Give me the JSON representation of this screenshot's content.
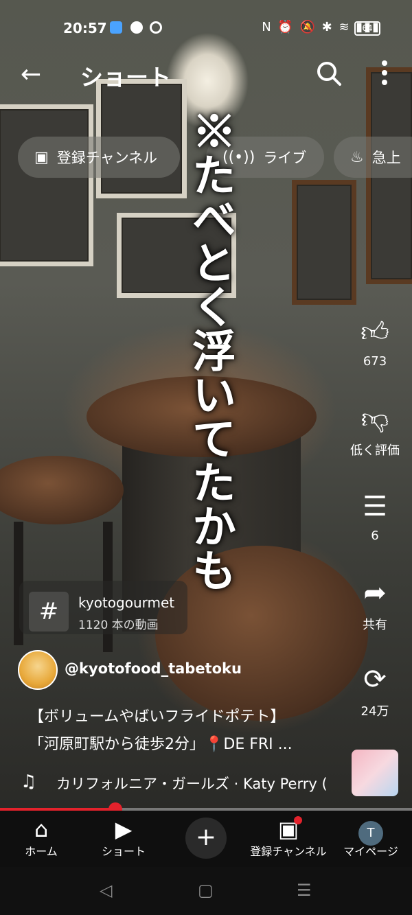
{
  "status_bar": {
    "time": "20:57",
    "battery": "64"
  },
  "header": {
    "title": "ショート"
  },
  "chips": [
    {
      "label": "登録チャンネル",
      "icon": "subscriptions-icon"
    },
    {
      "label": "ライブ",
      "icon": "live-icon"
    },
    {
      "label": "急上",
      "icon": "trending-icon"
    }
  ],
  "video": {
    "overlay_text": "※たべとく浮いてたかも"
  },
  "rail": {
    "like_count": "673",
    "dislike_label": "低く評価",
    "comment_count": "6",
    "share_label": "共有",
    "remix_count": "24万"
  },
  "hashtag": {
    "symbol": "#",
    "name": "kyotogourmet",
    "count": "1120 本の動画"
  },
  "channel": {
    "handle": "@kyotofood_tabetoku"
  },
  "caption": {
    "line1": "【ボリュームやばいフライドポテト】",
    "line2": "「河原町駅から徒歩2分」📍DE FRI ..."
  },
  "music": {
    "track": "カリフォルニア・ガールズ · Katy Perry ("
  },
  "progress": {
    "fraction": 0.28
  },
  "nav": {
    "home": "ホーム",
    "shorts": "ショート",
    "create": "+",
    "subscriptions": "登録チャンネル",
    "my_page": "マイページ",
    "avatar_letter": "T"
  },
  "colors": {
    "accent": "#e3222c",
    "navbar": "#0f0f0f"
  }
}
